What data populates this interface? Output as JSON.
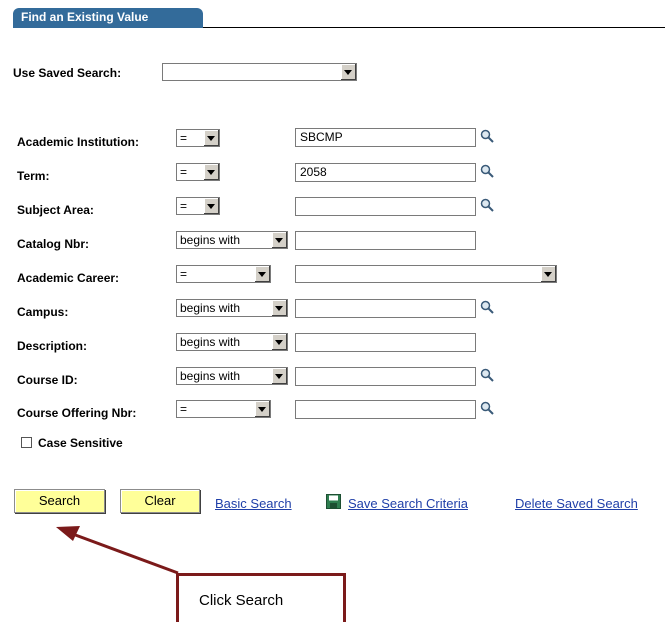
{
  "tab": {
    "title": "Find an Existing Value"
  },
  "saved_search": {
    "label": "Use Saved Search:",
    "value": ""
  },
  "fields": [
    {
      "label": "Academic Institution:",
      "operator": "=",
      "value": "SBCMP",
      "lookup": true
    },
    {
      "label": "Term:",
      "operator": "=",
      "value": "2058",
      "lookup": true
    },
    {
      "label": "Subject Area:",
      "operator": "=",
      "value": "",
      "lookup": true
    },
    {
      "label": "Catalog Nbr:",
      "operator": "begins with",
      "value": "",
      "lookup": false
    },
    {
      "label": "Academic Career:",
      "operator": "=",
      "value": "",
      "lookup": false
    },
    {
      "label": "Campus:",
      "operator": "begins with",
      "value": "",
      "lookup": true
    },
    {
      "label": "Description:",
      "operator": "begins with",
      "value": "",
      "lookup": false
    },
    {
      "label": "Course ID:",
      "operator": "begins with",
      "value": "",
      "lookup": true
    },
    {
      "label": "Course Offering Nbr:",
      "operator": "=",
      "value": "",
      "lookup": true
    }
  ],
  "case_sensitive": {
    "label": "Case Sensitive",
    "checked": false
  },
  "buttons": {
    "search": "Search",
    "clear": "Clear"
  },
  "links": {
    "basic_search": "Basic Search",
    "save_criteria": "Save Search Criteria",
    "delete_saved": "Delete Saved Search"
  },
  "callout": {
    "text": "Click Search"
  },
  "colors": {
    "tab": "#336b9a",
    "button": "#ffff99",
    "link": "#1f3fa8",
    "callout": "#7b1a1a"
  },
  "icons": [
    "chevron-down-icon",
    "lookup-magnifier-icon",
    "save-disk-icon",
    "arrow-icon"
  ]
}
